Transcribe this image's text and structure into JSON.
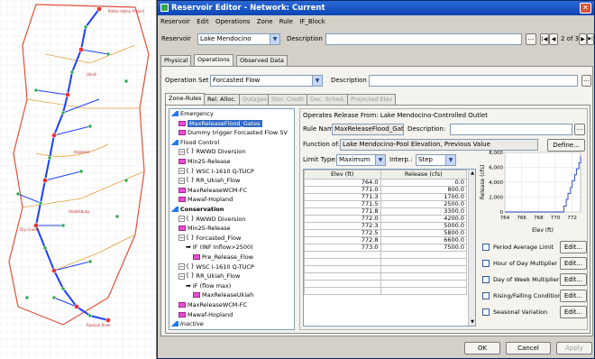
{
  "map": {
    "labels": [
      "Potter Valley Project",
      "Ukiah",
      "Hopland",
      "Healdsburg",
      "Dry Creek",
      "Russian River"
    ],
    "colors": {
      "stream": "#1e40ff",
      "boundary": "#e0503a",
      "subbasin": "#e6a23c",
      "node": "#2ea83a"
    }
  },
  "window": {
    "title": "Reservoir Editor - Network: Current",
    "menu": [
      "Reservoir",
      "Edit",
      "Operations",
      "Zone",
      "Rule",
      "IF_Block"
    ],
    "reservoir_label": "Reservoir",
    "reservoir_value": "Lake Mendocino",
    "description_label": "Description",
    "record_count": "2 of 3",
    "tabs": [
      "Physical",
      "Operations",
      "Observed Data"
    ],
    "active_tab": "Operations"
  },
  "operations": {
    "set_label": "Operation Set",
    "set_value": "Forcasted Flow",
    "description_label": "Description",
    "subtabs": [
      "Zone-Rules",
      "Rel. Alloc.",
      "Outages",
      "Stor. Credit",
      "Dec. Sched.",
      "Projected Elev"
    ],
    "tree": [
      {
        "text": "Emergency",
        "type": "zone",
        "indent": 0
      },
      {
        "text": "MaxReleaseFlood_Gates",
        "type": "rule",
        "indent": 1,
        "selected": true
      },
      {
        "text": "Dummy trigger Forcasted Flow SV",
        "type": "rule",
        "indent": 1
      },
      {
        "text": "Flood Control",
        "type": "zone",
        "indent": 0
      },
      {
        "text": "RWWD Diversion",
        "type": "if",
        "indent": 1
      },
      {
        "text": "Min25-Release",
        "type": "rule",
        "indent": 1
      },
      {
        "text": "WSC I-1610 Q-TUCP",
        "type": "if",
        "indent": 1
      },
      {
        "text": "RR_Ukiah_Flow",
        "type": "if",
        "indent": 1
      },
      {
        "text": "MaxReleaseWCM-FC",
        "type": "rule",
        "indent": 1
      },
      {
        "text": "Mawaf-Hopland",
        "type": "rule",
        "indent": 1
      },
      {
        "text": "Conservation",
        "type": "zone",
        "indent": 0,
        "bold": true
      },
      {
        "text": "RWWD Diversion",
        "type": "if",
        "indent": 1
      },
      {
        "text": "Min25-Release",
        "type": "rule",
        "indent": 1
      },
      {
        "text": "Forcasted_Flow",
        "type": "if",
        "indent": 1
      },
      {
        "text": "IF (INF Inflow>2500)",
        "type": "cond",
        "indent": 2
      },
      {
        "text": "Pre_Release_Flow",
        "type": "rule",
        "indent": 3
      },
      {
        "text": "WSC I-1610 Q-TUCP",
        "type": "if",
        "indent": 1
      },
      {
        "text": "RR_Ukiah_Flow",
        "type": "if",
        "indent": 1
      },
      {
        "text": "IF (flow max)",
        "type": "cond",
        "indent": 2
      },
      {
        "text": "MaxReleaseUkiah",
        "type": "rule",
        "indent": 3
      },
      {
        "text": "MaxReleaseWCM-FC",
        "type": "rule",
        "indent": 1
      },
      {
        "text": "Mawaf-Hopland",
        "type": "rule",
        "indent": 1
      },
      {
        "text": "Inactive",
        "type": "zone",
        "indent": 0,
        "italic": true
      }
    ]
  },
  "rule": {
    "heading": "Operates Release From: Lake Mendocino-Controlled Outlet",
    "name_label": "Rule Name:",
    "name_value": "MaxReleaseFlood_Gates",
    "description_label": "Description:",
    "function_label": "Function of:",
    "function_value": "Lake Mendocino-Pool Elevation, Previous Value",
    "define_btn": "Define...",
    "limit_label": "Limit Type:",
    "limit_value": "Maximum",
    "interp_label": "Interp.:",
    "interp_value": "Step",
    "table_headers": [
      "Elev (ft)",
      "Release (cfs)"
    ],
    "table_rows": [
      [
        "764.0",
        "0.0"
      ],
      [
        "771.0",
        "800.0"
      ],
      [
        "771.3",
        "1700.0"
      ],
      [
        "771.5",
        "2500.0"
      ],
      [
        "771.8",
        "3300.0"
      ],
      [
        "772.0",
        "4200.0"
      ],
      [
        "772.3",
        "5000.0"
      ],
      [
        "772.5",
        "5800.0"
      ],
      [
        "772.8",
        "6600.0"
      ],
      [
        "773.0",
        "7500.0"
      ]
    ],
    "options": [
      "Period Average Limit",
      "Hour of Day Multiplier",
      "Day of Week Multiplier",
      "Rising/Falling Condition",
      "Seasonal Variation"
    ],
    "edit_label": "Edit..."
  },
  "chart_data": {
    "type": "line",
    "x": [
      764.0,
      771.0,
      771.3,
      771.5,
      771.8,
      772.0,
      772.3,
      772.5,
      772.8,
      773.0
    ],
    "y": [
      0,
      800,
      1700,
      2500,
      3300,
      4200,
      5000,
      5800,
      6600,
      7500
    ],
    "xticks": [
      "764",
      "766",
      "768",
      "770",
      "772"
    ],
    "yticks": [
      "8,000",
      "6,000",
      "4,000",
      "2,000",
      "0"
    ],
    "xlabel": "Elev (ft)",
    "ylabel": "Release (cfs)",
    "xlim": [
      764,
      773
    ],
    "ylim": [
      0,
      8000
    ]
  },
  "buttons": {
    "ok": "OK",
    "cancel": "Cancel",
    "apply": "Apply"
  }
}
